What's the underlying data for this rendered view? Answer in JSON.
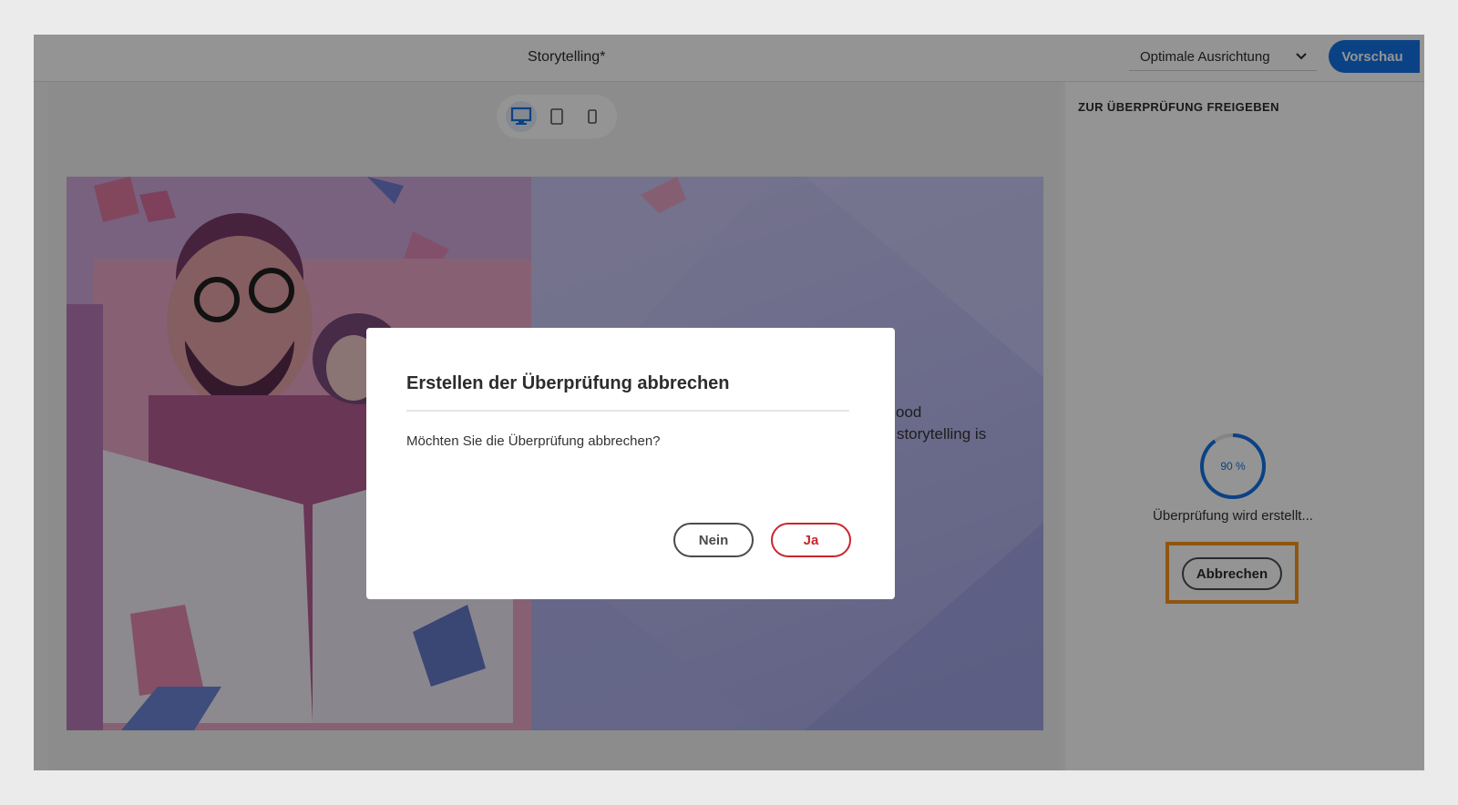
{
  "header": {
    "doc_title": "Storytelling*",
    "align_select_value": "Optimale Ausrichtung",
    "preview_label": "Vorschau"
  },
  "device_bar": {
    "icons": [
      "desktop-icon",
      "tablet-icon",
      "phone-icon"
    ],
    "active": "desktop-icon"
  },
  "slide": {
    "text_line_1": "nt- good",
    "text_line_2": "why storytelling is"
  },
  "side_panel": {
    "title": "ZUR ÜBERPRÜFUNG FREIGEBEN",
    "progress_percent": 90,
    "progress_label": "90 %",
    "status_text": "Überprüfung wird erstellt...",
    "cancel_label": "Abbrechen"
  },
  "dialog": {
    "title": "Erstellen der Überprüfung abbrechen",
    "body": "Möchten Sie die Überprüfung abbrechen?",
    "no_label": "Nein",
    "yes_label": "Ja"
  },
  "colors": {
    "accent": "#1473e6",
    "danger": "#c9252d",
    "highlight": "#f7941d"
  }
}
